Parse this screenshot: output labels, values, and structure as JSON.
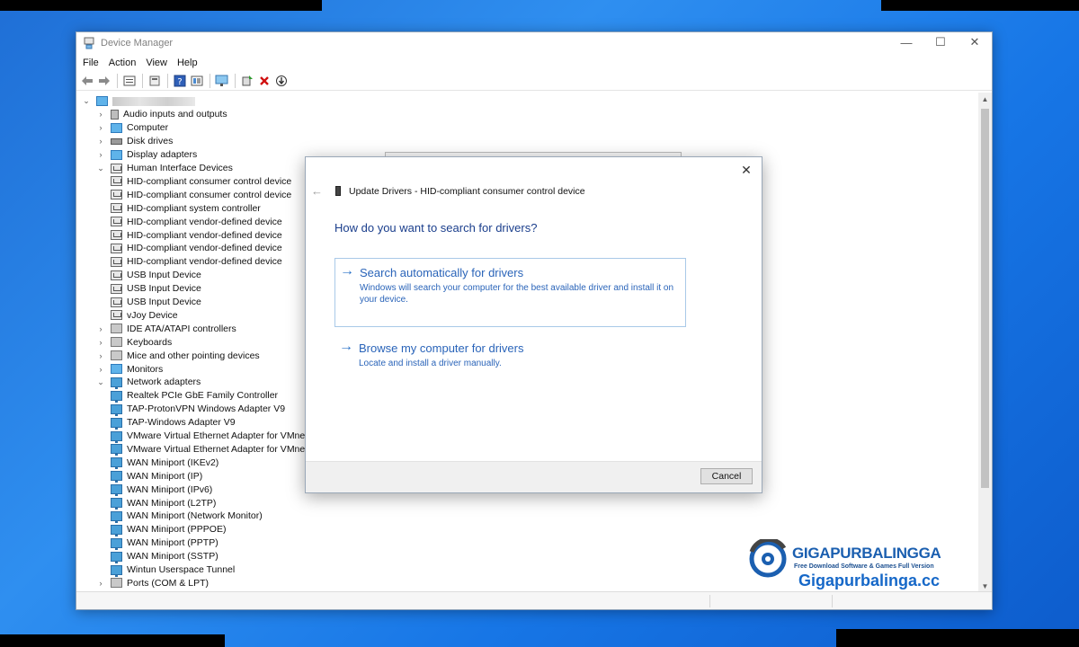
{
  "window": {
    "title": "Device Manager",
    "controls": {
      "minimize": "—",
      "maximize": "☐",
      "close": "✕"
    }
  },
  "menu": [
    "File",
    "Action",
    "View",
    "Help"
  ],
  "toolbar": {
    "icons": [
      "back-arrow-icon",
      "forward-arrow-icon",
      "properties-icon",
      "update-driver-icon",
      "help-icon",
      "view-icon",
      "scan-hardware-icon",
      "add-driver-icon",
      "uninstall-icon",
      "download-icon"
    ]
  },
  "tree": {
    "items": [
      {
        "label": "Audio inputs and outputs",
        "indent": 1,
        "expander": "›",
        "icon": "audio"
      },
      {
        "label": "Computer",
        "indent": 1,
        "expander": "›",
        "icon": "mon"
      },
      {
        "label": "Disk drives",
        "indent": 1,
        "expander": "›",
        "icon": "disk"
      },
      {
        "label": "Display adapters",
        "indent": 1,
        "expander": "›",
        "icon": "mon"
      },
      {
        "label": "Human Interface Devices",
        "indent": 1,
        "expander": "⌄",
        "icon": "hid"
      },
      {
        "label": "HID-compliant consumer control device",
        "indent": 2,
        "expander": "",
        "icon": "hid"
      },
      {
        "label": "HID-compliant consumer control device",
        "indent": 2,
        "expander": "",
        "icon": "hid"
      },
      {
        "label": "HID-compliant system controller",
        "indent": 2,
        "expander": "",
        "icon": "hid"
      },
      {
        "label": "HID-compliant vendor-defined device",
        "indent": 2,
        "expander": "",
        "icon": "hid"
      },
      {
        "label": "HID-compliant vendor-defined device",
        "indent": 2,
        "expander": "",
        "icon": "hid"
      },
      {
        "label": "HID-compliant vendor-defined device",
        "indent": 2,
        "expander": "",
        "icon": "hid"
      },
      {
        "label": "HID-compliant vendor-defined device",
        "indent": 2,
        "expander": "",
        "icon": "hid"
      },
      {
        "label": "USB Input Device",
        "indent": 2,
        "expander": "",
        "icon": "hid"
      },
      {
        "label": "USB Input Device",
        "indent": 2,
        "expander": "",
        "icon": "hid"
      },
      {
        "label": "USB Input Device",
        "indent": 2,
        "expander": "",
        "icon": "hid"
      },
      {
        "label": "vJoy Device",
        "indent": 2,
        "expander": "",
        "icon": "hid"
      },
      {
        "label": "IDE ATA/ATAPI controllers",
        "indent": 1,
        "expander": "›",
        "icon": "gray"
      },
      {
        "label": "Keyboards",
        "indent": 1,
        "expander": "›",
        "icon": "gray"
      },
      {
        "label": "Mice and other pointing devices",
        "indent": 1,
        "expander": "›",
        "icon": "gray"
      },
      {
        "label": "Monitors",
        "indent": 1,
        "expander": "›",
        "icon": "mon"
      },
      {
        "label": "Network adapters",
        "indent": 1,
        "expander": "⌄",
        "icon": "net"
      },
      {
        "label": "Realtek PCIe GbE Family Controller",
        "indent": 2,
        "expander": "",
        "icon": "net"
      },
      {
        "label": "TAP-ProtonVPN Windows Adapter V9",
        "indent": 2,
        "expander": "",
        "icon": "net"
      },
      {
        "label": "TAP-Windows Adapter V9",
        "indent": 2,
        "expander": "",
        "icon": "net"
      },
      {
        "label": "VMware Virtual Ethernet Adapter for VMnet",
        "indent": 2,
        "expander": "",
        "icon": "net"
      },
      {
        "label": "VMware Virtual Ethernet Adapter for VMnet",
        "indent": 2,
        "expander": "",
        "icon": "net"
      },
      {
        "label": "WAN Miniport (IKEv2)",
        "indent": 2,
        "expander": "",
        "icon": "net"
      },
      {
        "label": "WAN Miniport (IP)",
        "indent": 2,
        "expander": "",
        "icon": "net"
      },
      {
        "label": "WAN Miniport (IPv6)",
        "indent": 2,
        "expander": "",
        "icon": "net"
      },
      {
        "label": "WAN Miniport (L2TP)",
        "indent": 2,
        "expander": "",
        "icon": "net"
      },
      {
        "label": "WAN Miniport (Network Monitor)",
        "indent": 2,
        "expander": "",
        "icon": "net"
      },
      {
        "label": "WAN Miniport (PPPOE)",
        "indent": 2,
        "expander": "",
        "icon": "net"
      },
      {
        "label": "WAN Miniport (PPTP)",
        "indent": 2,
        "expander": "",
        "icon": "net"
      },
      {
        "label": "WAN Miniport (SSTP)",
        "indent": 2,
        "expander": "",
        "icon": "net"
      },
      {
        "label": "Wintun Userspace Tunnel",
        "indent": 2,
        "expander": "",
        "icon": "net"
      },
      {
        "label": "Ports (COM & LPT)",
        "indent": 1,
        "expander": "›",
        "icon": "gray"
      }
    ]
  },
  "dialog": {
    "title": "Update Drivers - HID-compliant consumer control device",
    "heading": "How do you want to search for drivers?",
    "option_auto": {
      "title": "Search automatically for drivers",
      "desc": "Windows will search your computer for the best available driver and install it on your device."
    },
    "option_browse": {
      "title": "Browse my computer for drivers",
      "desc": "Locate and install a driver manually."
    },
    "cancel": "Cancel",
    "close": "✕",
    "back": "←"
  },
  "watermark": {
    "brand": "GIGAPURBALINGGA",
    "tagline": "Free Download Software & Games Full Version",
    "url": "Gigapurbalinga.cc"
  },
  "colors": {
    "desktop": "#1f6fd6",
    "dialog_link": "#2a64b9",
    "dialog_heading": "#1a3e8c",
    "watermark_blue": "#1668c8"
  }
}
